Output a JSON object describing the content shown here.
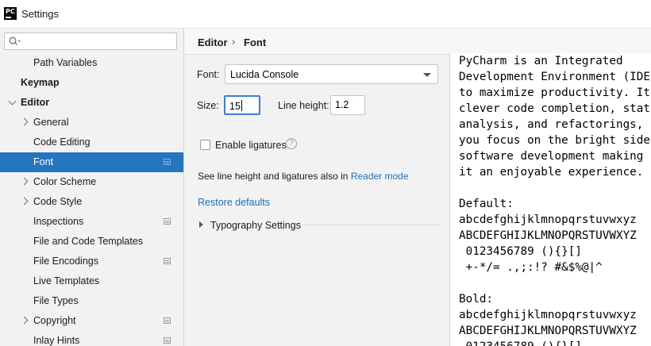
{
  "window": {
    "title": "Settings",
    "app_icon_text": "PC"
  },
  "search": {
    "placeholder": "",
    "value": ""
  },
  "sidebar": {
    "items": [
      {
        "label": "Path Variables",
        "level": 2
      },
      {
        "label": "Keymap",
        "level": 0
      },
      {
        "label": "Editor",
        "level": 0
      },
      {
        "label": "General",
        "level": 1
      },
      {
        "label": "Code Editing",
        "level": 1
      },
      {
        "label": "Font",
        "level": 1
      },
      {
        "label": "Color Scheme",
        "level": 1
      },
      {
        "label": "Code Style",
        "level": 1
      },
      {
        "label": "Inspections",
        "level": 1
      },
      {
        "label": "File and Code Templates",
        "level": 1
      },
      {
        "label": "File Encodings",
        "level": 1
      },
      {
        "label": "Live Templates",
        "level": 1
      },
      {
        "label": "File Types",
        "level": 1
      },
      {
        "label": "Copyright",
        "level": 1
      },
      {
        "label": "Inlay Hints",
        "level": 1
      }
    ],
    "selected": "Font"
  },
  "breadcrumb": {
    "parent": "Editor",
    "separator": "›",
    "current": "Font"
  },
  "font": {
    "label": "Font:",
    "value": "Lucida Console",
    "size_label": "Size:",
    "size_value": "15",
    "line_height_label": "Line height:",
    "line_height_value": "1.2",
    "ligatures_label": "Enable ligatures",
    "ligatures_checked": false,
    "help_glyph": "?",
    "hint_text": "See line height and ligatures also in",
    "hint_link": "Reader mode",
    "restore_defaults": "Restore defaults",
    "typography_settings": "Typography Settings"
  },
  "preview": {
    "lines": [
      "PyCharm is an Integrated",
      "Development Environment (IDE",
      "to maximize productivity. It",
      "clever code completion, stat",
      "analysis, and refactorings,",
      "you focus on the bright side",
      "software development making",
      "it an enjoyable experience.",
      "",
      "Default:",
      "abcdefghijklmnopqrstuvwxyz",
      "ABCDEFGHIJKLMNOPQRSTUVWXYZ",
      " 0123456789 (){}[]",
      " +-*/= .,;:!? #&$%@|^",
      "",
      "Bold:",
      "abcdefghijklmnopqrstuvwxyz",
      "ABCDEFGHIJKLMNOPQRSTUVWXYZ",
      " 0123456789 (){}[]"
    ]
  },
  "colors": {
    "selection": "#2675bf",
    "link": "#2470b3",
    "focus_border": "#3d7dd6"
  }
}
